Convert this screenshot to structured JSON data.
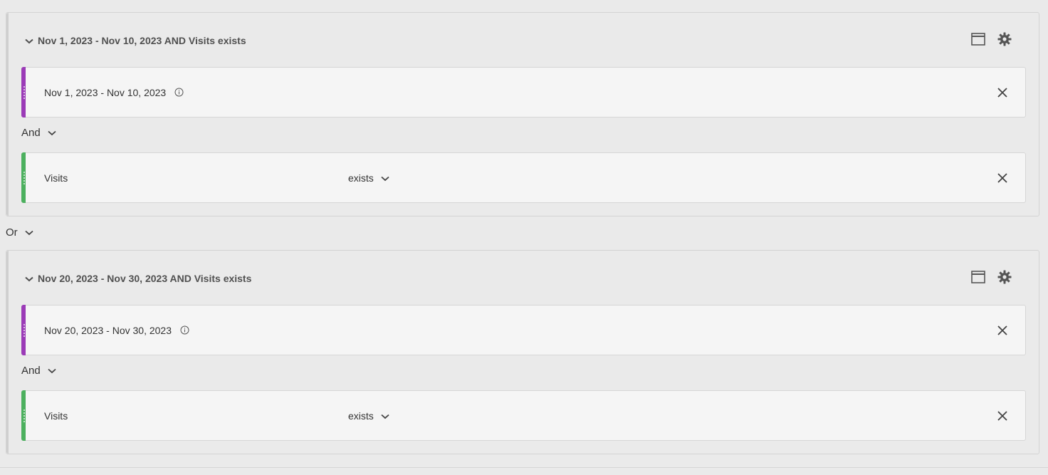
{
  "groups": [
    {
      "title": "Nov 1, 2023 - Nov 10, 2023 AND Visits exists",
      "date_rule": {
        "label": "Nov 1, 2023 - Nov 10, 2023",
        "icon": "info-icon"
      },
      "connector": "And",
      "metric_rule": {
        "label": "Visits",
        "operator": "exists"
      }
    },
    {
      "title": "Nov 20, 2023 - Nov 30, 2023 AND Visits exists",
      "date_rule": {
        "label": "Nov 20, 2023 - Nov 30, 2023",
        "icon": "info-icon"
      },
      "connector": "And",
      "metric_rule": {
        "label": "Visits",
        "operator": "exists"
      }
    }
  ],
  "group_connector": "Or",
  "colors": {
    "date_bar": "#9b3bb7",
    "metric_bar": "#4cb05e"
  }
}
